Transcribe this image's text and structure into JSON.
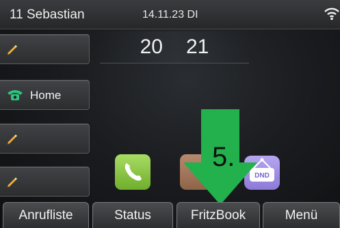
{
  "status_bar": {
    "account": "11 Sebastian",
    "date": "14.11.23 DI",
    "wifi_icon": "wifi-icon"
  },
  "clock": {
    "hour": "20",
    "minute": "21"
  },
  "line_keys": [
    {
      "label": "",
      "icon": "pencil-icon"
    },
    {
      "label": "Home",
      "icon": "phone-icon"
    },
    {
      "label": "",
      "icon": "pencil-icon"
    },
    {
      "label": "",
      "icon": "pencil-icon"
    }
  ],
  "apps": [
    {
      "icon": "phone-handset-icon"
    },
    {
      "icon": "app-icon"
    },
    {
      "icon": "dnd-icon",
      "label": "DND"
    }
  ],
  "overlay": {
    "step_label": "5.",
    "arrow_color": "#22b14c"
  },
  "softkeys": [
    "Anrufliste",
    "Status",
    "FritzBook",
    "Menü"
  ]
}
